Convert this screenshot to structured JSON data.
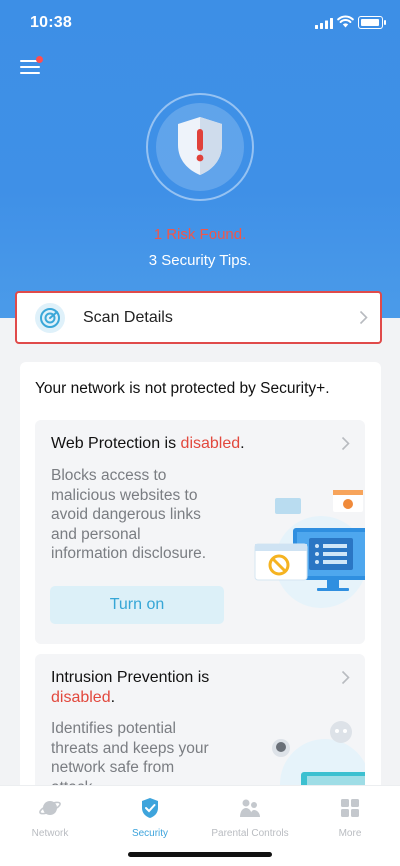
{
  "status_bar": {
    "time": "10:38"
  },
  "hero": {
    "risk_text": "1 Risk Found.",
    "tips_text": "3 Security Tips."
  },
  "scan": {
    "label": "Scan Details"
  },
  "main": {
    "notice": "Your network is not protected by Security+.",
    "web_protection": {
      "title": "Web Protection is ",
      "status": "disabled",
      "punct": ".",
      "desc_lines": [
        "Blocks access to",
        "malicious websites to",
        "avoid dangerous links",
        "and personal",
        "information disclosure."
      ],
      "button": "Turn on"
    },
    "intrusion": {
      "title": "Intrusion Prevention is",
      "status": "disabled",
      "punct": ".",
      "desc_lines": [
        "Identifies potential",
        "threats and keeps your",
        "network safe from",
        "attack."
      ]
    }
  },
  "tabs": [
    {
      "label": "Network",
      "icon": "planet-icon"
    },
    {
      "label": "Security",
      "icon": "shield-check-icon"
    },
    {
      "label": "Parental Controls",
      "icon": "family-icon"
    },
    {
      "label": "More",
      "icon": "grid-icon"
    }
  ],
  "colors": {
    "accent": "#3ea4dc",
    "danger": "#e2483d",
    "hero": "#3f90e7"
  }
}
